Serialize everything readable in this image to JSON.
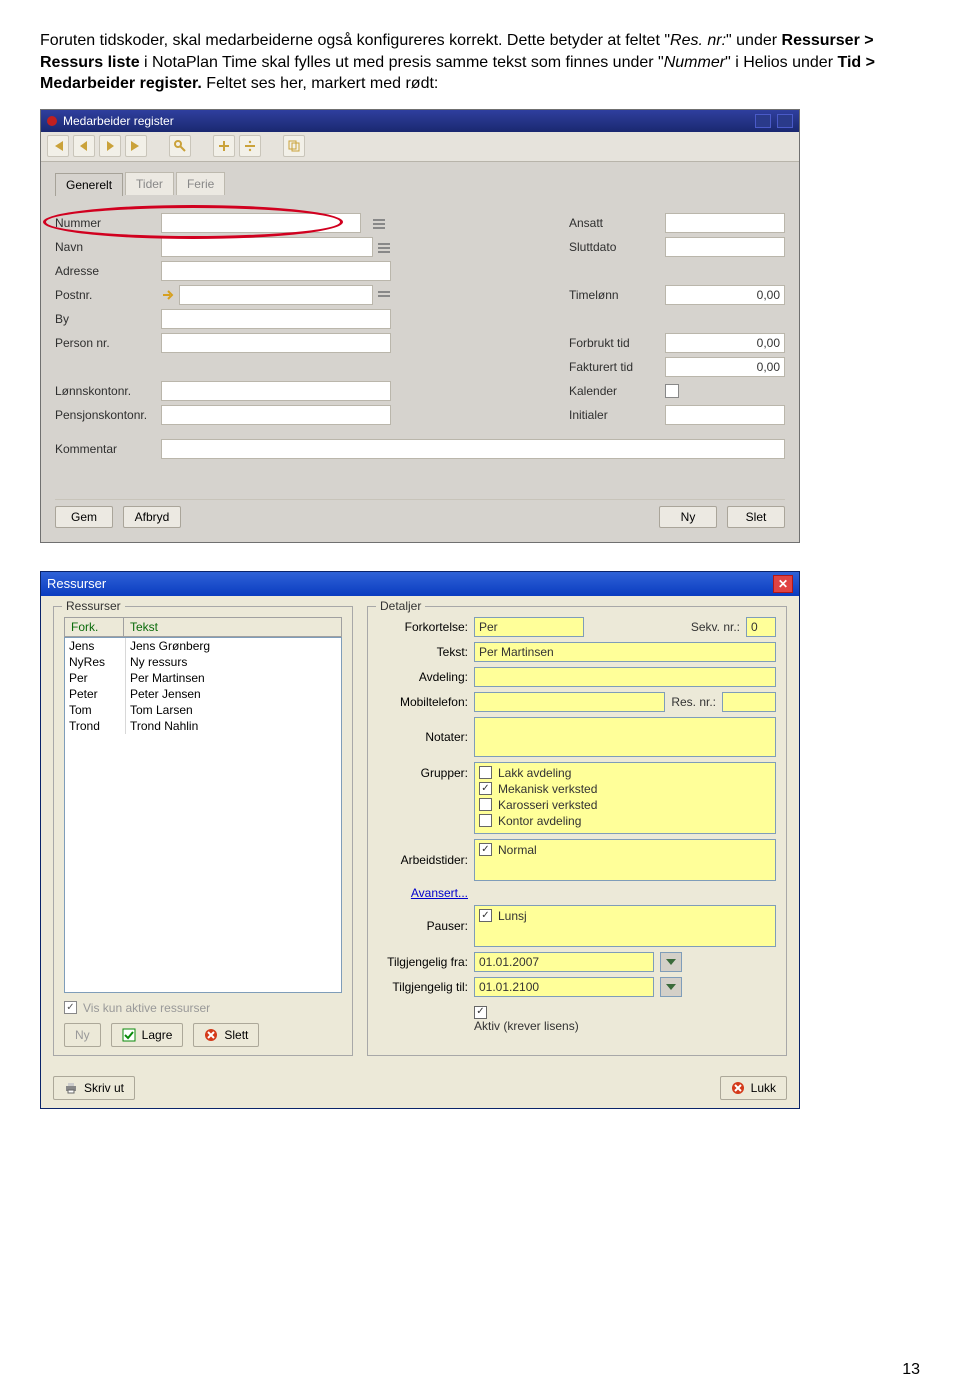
{
  "intro": {
    "line1a": "Foruten tidskoder, skal medarbeiderne også konfigureres korrekt. Dette betyder at feltet \"",
    "line1b_italic": "Res. nr:",
    "line1c": "\" under ",
    "boldpath": "Ressurser > Ressurs liste",
    "line1d": " i NotaPlan Time skal fylles ut med presis samme tekst som finnes under \"",
    "line1e_italic": "Nummer",
    "line1f": "\" i Helios under ",
    "boldpath2": "Tid > Medarbeider register.",
    "line1g": " Feltet ses her, markert med rødt:"
  },
  "medarb": {
    "title": "Medarbeider register",
    "tabs": [
      "Generelt",
      "Tider",
      "Ferie"
    ],
    "left_labels": [
      "Nummer",
      "Navn",
      "Adresse",
      "Postnr.",
      "By",
      "Person nr.",
      "Lønnskontonr.",
      "Pensjonskontonr.",
      "Kommentar"
    ],
    "right": {
      "ansatt": "Ansatt",
      "sluttdato": "Sluttdato",
      "timelonn": "Timelønn",
      "timelonn_val": "0,00",
      "forbrukt": "Forbrukt tid",
      "forbrukt_val": "0,00",
      "fakturert": "Fakturert tid",
      "fakturert_val": "0,00",
      "kalender": "Kalender",
      "initialer": "Initialer"
    },
    "buttons": {
      "save": "Gem",
      "cancel": "Afbryd",
      "new": "Ny",
      "delete": "Slet"
    }
  },
  "ressurser": {
    "title": "Ressurser",
    "legend_left": "Ressurser",
    "legend_right": "Detaljer",
    "cols": [
      "Fork.",
      "Tekst"
    ],
    "rows": [
      {
        "fork": "Jens",
        "tekst": "Jens Grønberg"
      },
      {
        "fork": "NyRes",
        "tekst": "Ny ressurs"
      },
      {
        "fork": "Per",
        "tekst": "Per Martinsen"
      },
      {
        "fork": "Peter",
        "tekst": "Peter Jensen"
      },
      {
        "fork": "Tom",
        "tekst": "Tom Larsen"
      },
      {
        "fork": "Trond",
        "tekst": "Trond Nahlin"
      }
    ],
    "vis_kun": "Vis kun aktive ressurser",
    "left_buttons": {
      "ny": "Ny",
      "lagre": "Lagre",
      "slett": "Slett"
    },
    "det": {
      "forkortelse": "Forkortelse:",
      "forkortelse_val": "Per",
      "sekv": "Sekv. nr.:",
      "sekv_val": "0",
      "tekst": "Tekst:",
      "tekst_val": "Per Martinsen",
      "avdeling": "Avdeling:",
      "mobil": "Mobiltelefon:",
      "resnr": "Res. nr.:",
      "notater": "Notater:",
      "grupper": "Grupper:",
      "grupper_items": [
        "Lakk avdeling",
        "Mekanisk verksted",
        "Karosseri verksted",
        "Kontor avdeling"
      ],
      "grupper_checked": [
        false,
        true,
        false,
        false
      ],
      "arbeids": "Arbeidstider:",
      "arbeids_item": "Normal",
      "avansert": "Avansert...",
      "pauser": "Pauser:",
      "pauser_item": "Lunsj",
      "tilg_fra": "Tilgjengelig fra:",
      "tilg_fra_val": "01.01.2007",
      "tilg_til": "Tilgjengelig til:",
      "tilg_til_val": "01.01.2100",
      "aktiv": "Aktiv (krever lisens)"
    },
    "footer": {
      "skriv": "Skriv ut",
      "lukk": "Lukk"
    }
  },
  "page_number": "13"
}
